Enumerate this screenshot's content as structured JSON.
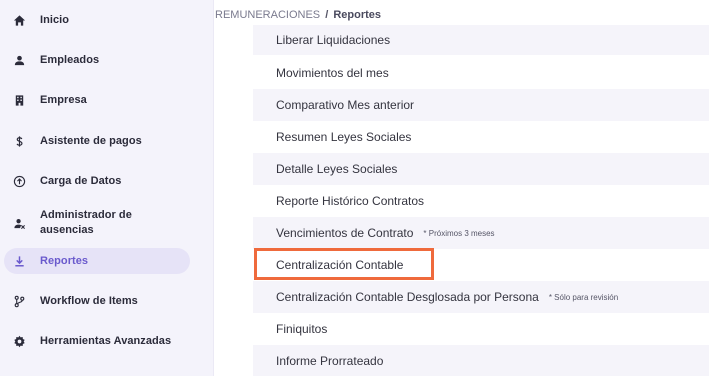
{
  "sidebar": {
    "items": [
      {
        "label": "Inicio",
        "icon": "home-icon"
      },
      {
        "label": "Empleados",
        "icon": "user-icon"
      },
      {
        "label": "Empresa",
        "icon": "building-icon"
      },
      {
        "label": "Asistente de pagos",
        "icon": "dollar-icon"
      },
      {
        "label": "Carga de Datos",
        "icon": "upload-circle-icon"
      },
      {
        "label": "Administrador de ausencias",
        "icon": "user-off-icon"
      },
      {
        "label": "Reportes",
        "icon": "download-icon",
        "active": true
      },
      {
        "label": "Workflow de Items",
        "icon": "branch-icon"
      },
      {
        "label": "Herramientas Avanzadas",
        "icon": "gear-icon"
      }
    ]
  },
  "breadcrumb": {
    "parent": "REMUNERACIONES",
    "separator": "/",
    "current": "Reportes"
  },
  "reports": {
    "items": [
      {
        "label": "Liberar Liquidaciones",
        "note": ""
      },
      {
        "label": "Movimientos del mes",
        "note": ""
      },
      {
        "label": "Comparativo Mes anterior",
        "note": ""
      },
      {
        "label": "Resumen Leyes Sociales",
        "note": ""
      },
      {
        "label": "Detalle Leyes Sociales",
        "note": ""
      },
      {
        "label": "Reporte Histórico Contratos",
        "note": ""
      },
      {
        "label": "Vencimientos de Contrato",
        "note": "* Próximos 3 meses"
      },
      {
        "label": "Centralización Contable",
        "note": "",
        "highlighted": true
      },
      {
        "label": "Centralización Contable Desglosada por Persona",
        "note": "* Sólo para revisión"
      },
      {
        "label": "Finiquitos",
        "note": ""
      },
      {
        "label": "Informe Prorrateado",
        "note": ""
      }
    ]
  },
  "colors": {
    "accent": "#6a5acd",
    "highlight_border": "#ef6a3c",
    "sidebar_bg": "#f4f3fb",
    "row_alt_bg": "#f5f4fa"
  }
}
